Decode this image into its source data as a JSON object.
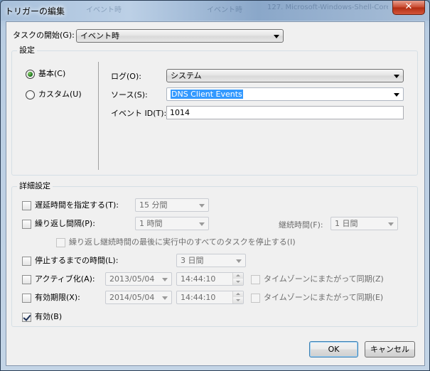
{
  "window": {
    "title": "トリガーの編集",
    "close_glyph": "✕"
  },
  "background_window_text": [
    "イベント時",
    "イベント時",
    "127. Microsoft-Windows-Shell-Core"
  ],
  "task_start": {
    "label": "タスクの開始(G):",
    "value": "イベント時"
  },
  "settings": {
    "group_title": "設定",
    "radio_basic": {
      "label": "基本(C)",
      "checked": true
    },
    "radio_custom": {
      "label": "カスタム(U)",
      "checked": false
    },
    "log": {
      "label": "ログ(O):",
      "value": "システム"
    },
    "source": {
      "label": "ソース(S):",
      "value": "DNS Client Events"
    },
    "event_id": {
      "label": "イベント ID(T):",
      "value": "1014"
    }
  },
  "advanced": {
    "group_title": "詳細設定",
    "delay": {
      "label": "遅延時間を指定する(T):",
      "value": "15 分間",
      "checked": false
    },
    "repeat": {
      "label": "繰り返し間隔(P):",
      "value": "1 時間",
      "checked": false
    },
    "duration": {
      "label": "継続時間(F):",
      "value": "1 日間"
    },
    "stop_running": {
      "label": "繰り返し継続時間の最後に実行中のすべてのタスクを停止する(I)",
      "checked": false
    },
    "stop_after": {
      "label": "停止するまでの時間(L):",
      "value": "3 日間",
      "checked": false
    },
    "activate": {
      "label": "アクティブ化(A):",
      "date": "2013/05/04",
      "time": "14:44:10",
      "checked": false
    },
    "activate_tz": {
      "label": "タイムゾーンにまたがって同期(Z)",
      "checked": false
    },
    "expire": {
      "label": "有効期限(X):",
      "date": "2014/05/04",
      "time": "14:44:10",
      "checked": false
    },
    "expire_tz": {
      "label": "タイムゾーンにまたがって同期(E)",
      "checked": false
    },
    "enabled": {
      "label": "有効(B)",
      "checked": true
    }
  },
  "buttons": {
    "ok": "OK",
    "cancel": "キャンセル"
  }
}
